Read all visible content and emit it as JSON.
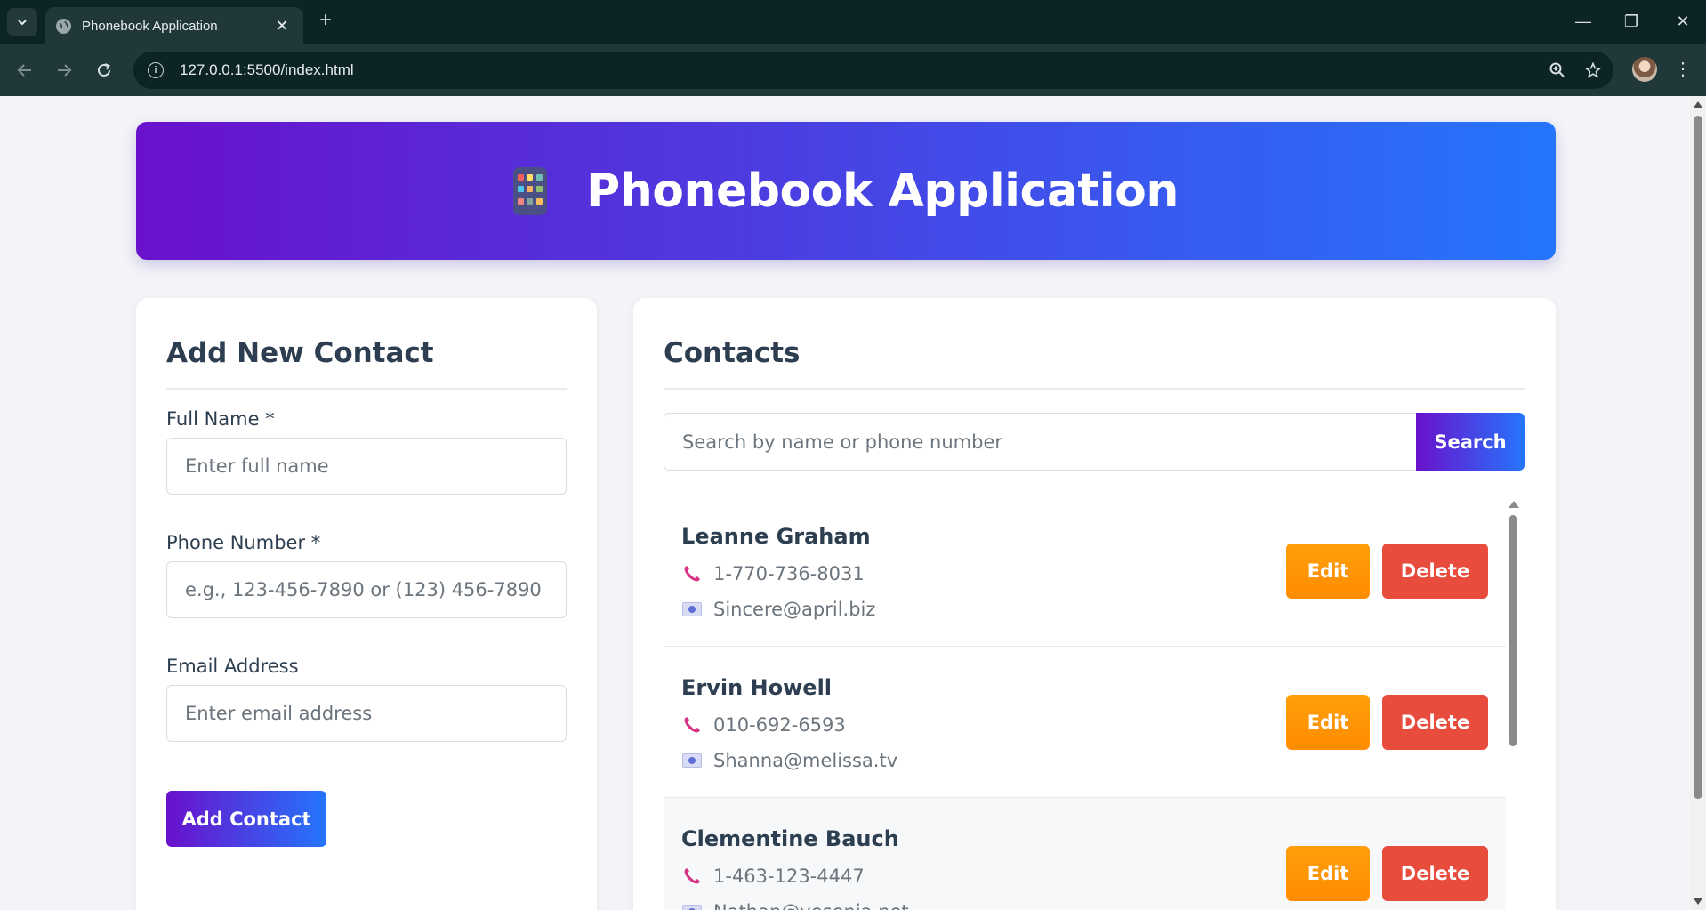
{
  "browser": {
    "tab_title": "Phonebook Application",
    "url": "127.0.0.1:5500/index.html"
  },
  "header": {
    "title": "Phonebook Application",
    "icon": "mobile-phone-icon",
    "gradient": [
      "#6a11cb",
      "#2575fc"
    ]
  },
  "add_form": {
    "heading": "Add New Contact",
    "fields": [
      {
        "label": "Full Name *",
        "placeholder": "Enter full name",
        "value": ""
      },
      {
        "label": "Phone Number *",
        "placeholder": "e.g., 123-456-7890 or (123) 456-7890",
        "value": ""
      },
      {
        "label": "Email Address",
        "placeholder": "Enter email address",
        "value": ""
      }
    ],
    "submit_label": "Add Contact"
  },
  "contacts_panel": {
    "heading": "Contacts",
    "search_placeholder": "Search by name or phone number",
    "search_value": "",
    "search_label": "Search",
    "edit_label": "Edit",
    "delete_label": "Delete",
    "contacts": [
      {
        "name": "Leanne Graham",
        "phone": "1-770-736-8031",
        "email": "Sincere@april.biz"
      },
      {
        "name": "Ervin Howell",
        "phone": "010-692-6593",
        "email": "Shanna@melissa.tv"
      },
      {
        "name": "Clementine Bauch",
        "phone": "1-463-123-4447",
        "email": "Nathan@yesenia.net"
      }
    ]
  },
  "colors": {
    "edit": "#ff8c00",
    "delete": "#e74c3c",
    "heading_text": "#2c3e50",
    "muted_text": "#6c757d"
  }
}
